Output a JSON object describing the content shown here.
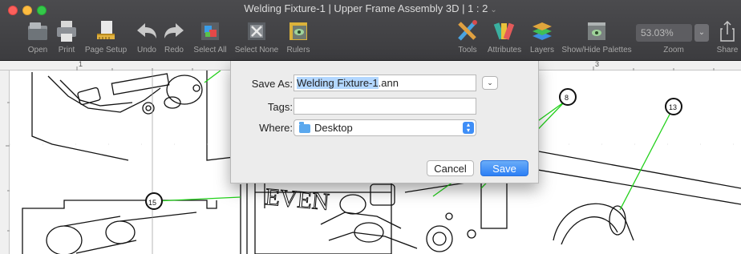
{
  "window": {
    "title": "Welding Fixture-1 | Upper Frame Assembly 3D | 1 : 2",
    "title_chevron": "⌄"
  },
  "toolbar": {
    "items": [
      {
        "label": "Open",
        "icon": "open-icon"
      },
      {
        "label": "Print",
        "icon": "print-icon"
      },
      {
        "label": "Page Setup",
        "icon": "page-setup-icon"
      },
      {
        "label": "Undo",
        "icon": "undo-icon"
      },
      {
        "label": "Redo",
        "icon": "redo-icon"
      },
      {
        "label": "Select All",
        "icon": "select-all-icon"
      },
      {
        "label": "Select None",
        "icon": "select-none-icon"
      },
      {
        "label": "Rulers",
        "icon": "rulers-icon"
      },
      {
        "label": "Tools",
        "icon": "tools-icon"
      },
      {
        "label": "Attributes",
        "icon": "attributes-icon"
      },
      {
        "label": "Layers",
        "icon": "layers-icon"
      },
      {
        "label": "Show/Hide Palettes",
        "icon": "palettes-icon"
      },
      {
        "label": "Zoom",
        "icon": "zoom-icon"
      },
      {
        "label": "Share",
        "icon": "share-icon"
      }
    ],
    "zoom_value": "53.03%"
  },
  "ruler": {
    "marks": [
      "1",
      "3"
    ]
  },
  "drawing": {
    "callouts": [
      "8",
      "13",
      "15"
    ],
    "engraved_text": "EVEN"
  },
  "save_dialog": {
    "save_as_label": "Save As:",
    "filename_selected": "Welding Fixture-1",
    "filename_ext": ".ann",
    "tags_label": "Tags:",
    "tags_value": "",
    "where_label": "Where:",
    "where_value": "Desktop",
    "cancel_label": "Cancel",
    "save_label": "Save"
  },
  "colors": {
    "accent": "#2c7ff5",
    "leader_line": "#22d11a",
    "titlebar": "#3f3f42"
  }
}
